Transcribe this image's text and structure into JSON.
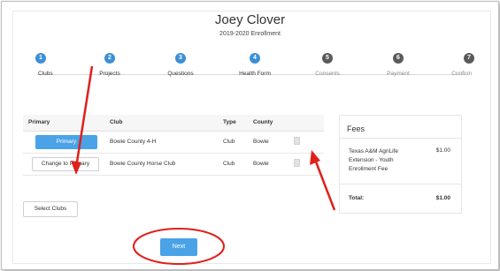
{
  "header": {
    "name": "Joey Clover",
    "subtitle": "2019-2020 Enrollment"
  },
  "steps": [
    {
      "number": "1",
      "label": "Clubs",
      "state": "active"
    },
    {
      "number": "2",
      "label": "Projects",
      "state": "active"
    },
    {
      "number": "3",
      "label": "Questions",
      "state": "active"
    },
    {
      "number": "4",
      "label": "Health Form",
      "state": "active"
    },
    {
      "number": "5",
      "label": "Consents",
      "state": "inactive"
    },
    {
      "number": "6",
      "label": "Payment",
      "state": "inactive"
    },
    {
      "number": "7",
      "label": "Confirm",
      "state": "inactive"
    }
  ],
  "clubs_table": {
    "headers": [
      "Primary",
      "Club",
      "Type",
      "County"
    ],
    "rows": [
      {
        "primary_label": "Primary",
        "club": "Bowie County 4-H",
        "type": "Club",
        "county": "Bowie"
      },
      {
        "primary_label": "Change to Primary",
        "club": "Bowie County Horse Club",
        "type": "Club",
        "county": "Bowie"
      }
    ]
  },
  "select_clubs_label": "Select Clubs",
  "fees": {
    "title": "Fees",
    "items": [
      {
        "description": "Texas A&M AgriLife Extension - Youth Enrollment Fee",
        "amount": "$1.00"
      }
    ],
    "total_label": "Total:",
    "total_amount": "$1.00"
  },
  "next_label": "Next",
  "colors": {
    "accent": "#3c8fd6",
    "button": "#4aa3e6",
    "annotation": "#e0201b"
  }
}
